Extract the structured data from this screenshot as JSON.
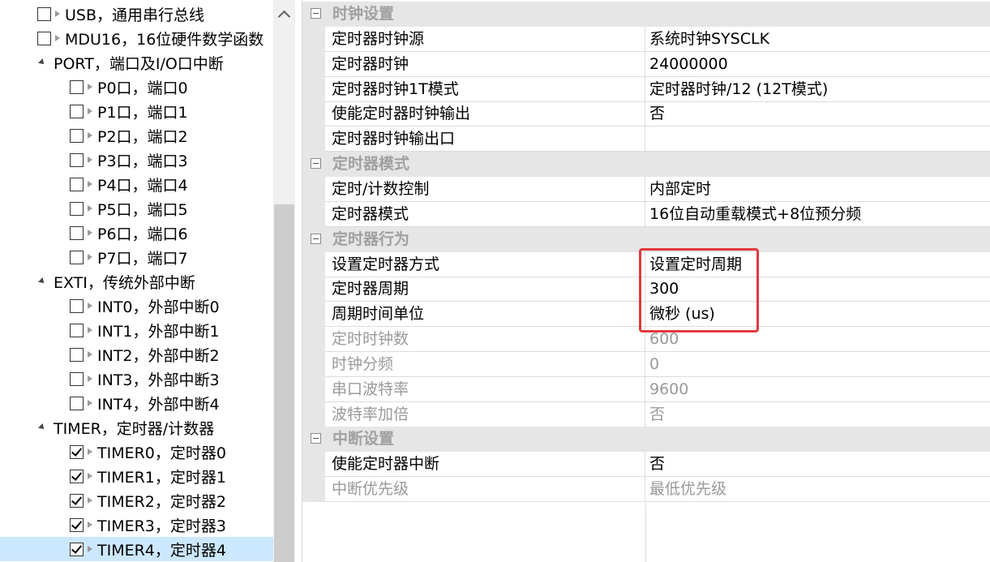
{
  "tree": {
    "items": [
      {
        "label": "USB，通用串行总线",
        "type": "item",
        "level": 0,
        "checked": false,
        "selected": false
      },
      {
        "label": "MDU16，16位硬件数学函数",
        "type": "item",
        "level": 0,
        "checked": false,
        "selected": false
      },
      {
        "label": "PORT，端口及I/O口中断",
        "type": "category",
        "level": 0
      },
      {
        "label": "P0口，端口0",
        "type": "item",
        "level": 1,
        "checked": false,
        "selected": false
      },
      {
        "label": "P1口，端口1",
        "type": "item",
        "level": 1,
        "checked": false,
        "selected": false
      },
      {
        "label": "P2口，端口2",
        "type": "item",
        "level": 1,
        "checked": false,
        "selected": false
      },
      {
        "label": "P3口，端口3",
        "type": "item",
        "level": 1,
        "checked": false,
        "selected": false
      },
      {
        "label": "P4口，端口4",
        "type": "item",
        "level": 1,
        "checked": false,
        "selected": false
      },
      {
        "label": "P5口，端口5",
        "type": "item",
        "level": 1,
        "checked": false,
        "selected": false
      },
      {
        "label": "P6口，端口6",
        "type": "item",
        "level": 1,
        "checked": false,
        "selected": false
      },
      {
        "label": "P7口，端口7",
        "type": "item",
        "level": 1,
        "checked": false,
        "selected": false
      },
      {
        "label": "EXTI，传统外部中断",
        "type": "category",
        "level": 0
      },
      {
        "label": "INT0，外部中断0",
        "type": "item",
        "level": 1,
        "checked": false,
        "selected": false
      },
      {
        "label": "INT1，外部中断1",
        "type": "item",
        "level": 1,
        "checked": false,
        "selected": false
      },
      {
        "label": "INT2，外部中断2",
        "type": "item",
        "level": 1,
        "checked": false,
        "selected": false
      },
      {
        "label": "INT3，外部中断3",
        "type": "item",
        "level": 1,
        "checked": false,
        "selected": false
      },
      {
        "label": "INT4，外部中断4",
        "type": "item",
        "level": 1,
        "checked": false,
        "selected": false
      },
      {
        "label": "TIMER，定时器/计数器",
        "type": "category",
        "level": 0
      },
      {
        "label": "TIMER0，定时器0",
        "type": "item",
        "level": 1,
        "checked": true,
        "selected": false
      },
      {
        "label": "TIMER1，定时器1",
        "type": "item",
        "level": 1,
        "checked": true,
        "selected": false
      },
      {
        "label": "TIMER2，定时器2",
        "type": "item",
        "level": 1,
        "checked": true,
        "selected": false
      },
      {
        "label": "TIMER3，定时器3",
        "type": "item",
        "level": 1,
        "checked": true,
        "selected": false
      },
      {
        "label": "TIMER4，定时器4",
        "type": "item",
        "level": 1,
        "checked": true,
        "selected": true
      }
    ]
  },
  "grid": {
    "rows": [
      {
        "type": "section",
        "title": "时钟设置"
      },
      {
        "type": "prop",
        "name": "定时器时钟源",
        "value": "系统时钟SYSCLK",
        "disabled": false
      },
      {
        "type": "prop",
        "name": "定时器时钟",
        "value": "24000000",
        "disabled": false
      },
      {
        "type": "prop",
        "name": "定时器时钟1T模式",
        "value": "定时器时钟/12 (12T模式)",
        "disabled": false
      },
      {
        "type": "prop",
        "name": "使能定时器时钟输出",
        "value": "否",
        "disabled": false
      },
      {
        "type": "prop",
        "name": "定时器时钟输出口",
        "value": "",
        "disabled": false
      },
      {
        "type": "section",
        "title": "定时器模式"
      },
      {
        "type": "prop",
        "name": "定时/计数控制",
        "value": "内部定时",
        "disabled": false
      },
      {
        "type": "prop",
        "name": "定时器模式",
        "value": "16位自动重载模式+8位预分频",
        "disabled": false
      },
      {
        "type": "section",
        "title": "定时器行为"
      },
      {
        "type": "prop",
        "name": "设置定时器方式",
        "value": "设置定时周期",
        "disabled": false
      },
      {
        "type": "prop",
        "name": "定时器周期",
        "value": "300",
        "disabled": false
      },
      {
        "type": "prop",
        "name": "周期时间单位",
        "value": "微秒 (us)",
        "disabled": false
      },
      {
        "type": "prop",
        "name": "定时时钟数",
        "value": "600",
        "disabled": true
      },
      {
        "type": "prop",
        "name": "时钟分频",
        "value": "0",
        "disabled": true
      },
      {
        "type": "prop",
        "name": "串口波特率",
        "value": "9600",
        "disabled": true
      },
      {
        "type": "prop",
        "name": "波特率加倍",
        "value": "否",
        "disabled": true
      },
      {
        "type": "section",
        "title": "中断设置"
      },
      {
        "type": "prop",
        "name": "使能定时器中断",
        "value": "否",
        "disabled": false
      },
      {
        "type": "prop",
        "name": "中断优先级",
        "value": "最低优先级",
        "disabled": true
      }
    ]
  },
  "colors": {
    "selection": "#cce8ff",
    "section_bg": "#e6e6e6",
    "disabled_text": "#9a9a9a",
    "highlight": "#e03a3e"
  },
  "icons": {
    "checkbox": "checkbox-icon",
    "tree_arrow": "arrow-right-icon",
    "expander": "expand-triangle-icon",
    "section_toggle": "collapse-minus-icon",
    "scroll_up": "chevron-up-icon"
  }
}
